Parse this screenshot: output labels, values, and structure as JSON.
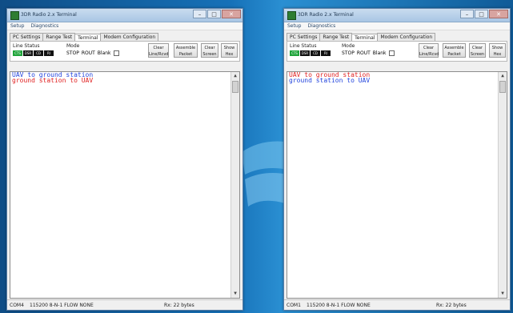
{
  "left_window": {
    "title": "3DR Radio 2.x Terminal",
    "menu": [
      "Setup",
      "Diagnostics"
    ],
    "tabs": [
      "PC Settings",
      "Range Test",
      "Terminal",
      "Modem Configuration"
    ],
    "active_tab": "Terminal",
    "toolbar": {
      "line_status_label": "Line Status",
      "leds": [
        "CTS",
        "DSR",
        "CD",
        "RI"
      ],
      "mode_label": "Mode",
      "mode_options": [
        "STOP",
        "ROUT",
        "Blank"
      ],
      "buttons": [
        "Clear Line/Rcvd",
        "Assemble Packet",
        "Clear Screen",
        "Show Hex"
      ]
    },
    "terminal_lines": [
      {
        "text": "UAV to ground station",
        "color": "#2244dd"
      },
      {
        "text": "ground station to UAV",
        "color": "#e02020"
      }
    ],
    "status": {
      "port": "COM4",
      "settings": "115200 8-N-1 FLOW NONE",
      "rx": "Rx: 22 bytes"
    }
  },
  "right_window": {
    "title": "3DR Radio 2.x Terminal",
    "menu": [
      "Setup",
      "Diagnostics"
    ],
    "tabs": [
      "PC Settings",
      "Range Test",
      "Terminal",
      "Modem Configuration"
    ],
    "active_tab": "Terminal",
    "toolbar": {
      "line_status_label": "Line Status",
      "leds": [
        "CTS",
        "DSR",
        "CD",
        "RI"
      ],
      "mode_label": "Mode",
      "mode_options": [
        "STOP",
        "ROUT",
        "Blank"
      ],
      "buttons": [
        "Clear Line/Rcvd",
        "Assemble Packet",
        "Clear Screen",
        "Show Hex"
      ]
    },
    "terminal_lines": [
      {
        "text": "UAV to ground station",
        "color": "#e02020"
      },
      {
        "text": "ground station to UAV",
        "color": "#2244dd"
      }
    ],
    "status": {
      "port": "COM1",
      "settings": "115200 8-N-1 FLOW NONE",
      "rx": "Rx: 22 bytes"
    }
  },
  "window_controls": {
    "minimize": "–",
    "maximize": "□",
    "close": "✕"
  }
}
